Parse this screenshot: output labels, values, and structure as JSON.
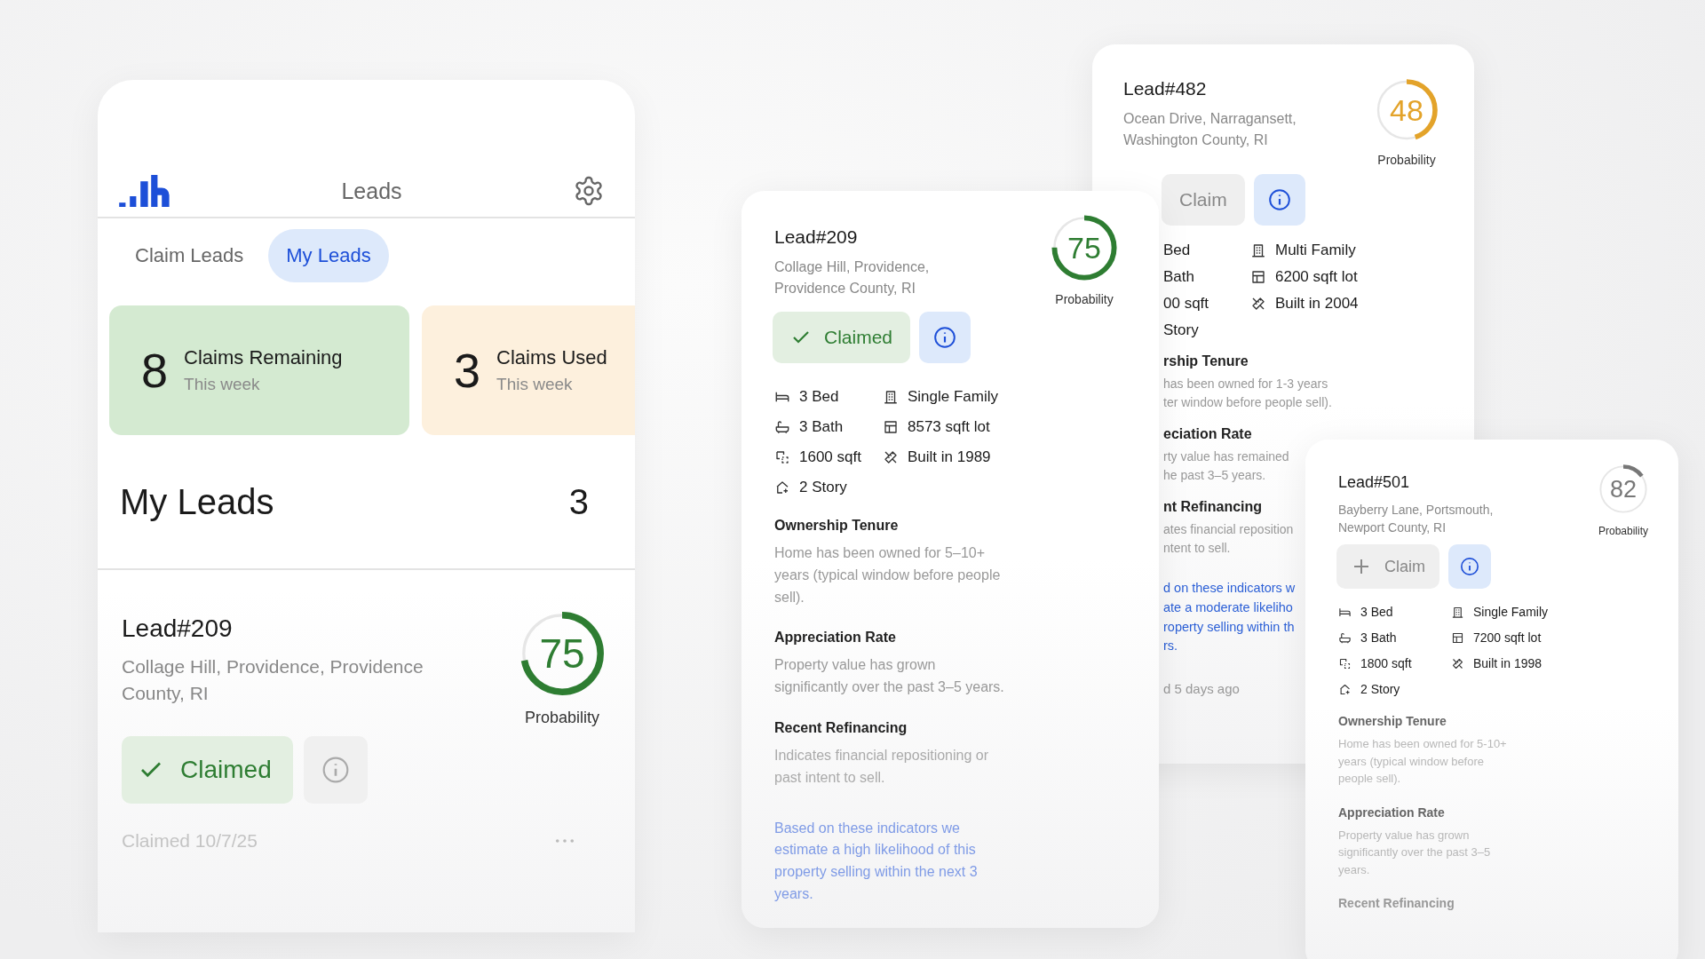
{
  "app": {
    "title": "Leads",
    "tabs": [
      {
        "label": "Claim Leads",
        "selected": false
      },
      {
        "label": "My Leads",
        "selected": true
      }
    ],
    "stats": [
      {
        "kind": "remaining",
        "value": "8",
        "label": "Claims Remaining",
        "sub": "This week"
      },
      {
        "kind": "used",
        "value": "3",
        "label": "Claims Used",
        "sub": "This week"
      }
    ],
    "section": {
      "title": "My Leads",
      "count": "3"
    },
    "lead": {
      "title": "Lead#209",
      "address": "Collage Hill, Providence, Providence County, RI",
      "probability": "75",
      "level": 0.72,
      "color": "#2e7d32",
      "probability_label": "Probability",
      "button": {
        "kind": "claimed",
        "label": "Claimed"
      },
      "claimed_date": "Claimed 10/7/25"
    }
  },
  "detail_cards": [
    {
      "kind": "full",
      "title": "Lead#209",
      "address": [
        "Collage Hill, Providence,",
        "Providence County, RI"
      ],
      "probability": "75",
      "level": 0.75,
      "color": "#2e7d32",
      "probability_label": "Probability",
      "button": {
        "kind": "claimed",
        "label": "Claimed"
      },
      "facts": [
        {
          "kind": "bed",
          "text": "3 Bed"
        },
        {
          "kind": "building",
          "text": "Single Family"
        },
        {
          "kind": "bath",
          "text": "3 Bath"
        },
        {
          "kind": "lot",
          "text": "8573 sqft lot"
        },
        {
          "kind": "area",
          "text": "1600 sqft"
        },
        {
          "kind": "ruler",
          "text": "Built in 1989"
        },
        {
          "kind": "story",
          "text": "2 Story"
        }
      ],
      "sections": [
        {
          "heading": "Ownership Tenure",
          "lines": [
            "Home has been owned for 5–10+",
            "years (typical window before people",
            "sell)."
          ]
        },
        {
          "heading": "Appreciation Rate",
          "lines": [
            "Property value has grown",
            "significantly over the past 3–5 years."
          ]
        },
        {
          "heading": "Recent Refinancing",
          "lines": [
            "Indicates financial repositioning or",
            "past intent to sell."
          ]
        }
      ],
      "summary": [
        "Based on these indicators we",
        "estimate a high likelihood of this",
        "property selling within the next 3",
        "years."
      ]
    },
    {
      "kind": "covered",
      "title": "Lead#482",
      "address": [
        "Ocean Drive, Narragansett,",
        "Washington County, RI"
      ],
      "probability": "48",
      "level": 0.45,
      "color": "#e3a32a",
      "probability_label": "Probability",
      "button": {
        "kind": "claim",
        "label": "Claim"
      },
      "facts": [
        {
          "kind": "text",
          "text": "Bed"
        },
        {
          "kind": "building",
          "text": "Multi Family"
        },
        {
          "kind": "text",
          "text": "Bath"
        },
        {
          "kind": "lot",
          "text": "6200 sqft lot"
        },
        {
          "kind": "text",
          "text": "00 sqft"
        },
        {
          "kind": "ruler",
          "text": "Built in 2004"
        },
        {
          "kind": "text",
          "text": "Story"
        }
      ],
      "sections": [
        {
          "heading": "rship Tenure",
          "lines": [
            "has been owned for 1-3 years",
            "ter window before people sell)."
          ]
        },
        {
          "heading": "eciation Rate",
          "lines": [
            "rty value has remained",
            "he past 3–5 years."
          ]
        },
        {
          "heading": "nt Refinancing",
          "lines": [
            "ates financial reposition",
            "ntent to sell."
          ]
        }
      ],
      "summary": [
        "d on these indicators w",
        "ate a moderate likeliho",
        "roperty selling within th",
        "rs."
      ],
      "footer": "d 5 days ago"
    },
    {
      "kind": "full",
      "title": "Lead#501",
      "address": [
        "Bayberry Lane, Portsmouth,",
        "Newport County, RI"
      ],
      "probability": "82",
      "level": 0.15,
      "color": "#777777",
      "probability_label": "Probability",
      "button": {
        "kind": "claim",
        "label": "Claim"
      },
      "facts": [
        {
          "kind": "bed",
          "text": "3 Bed"
        },
        {
          "kind": "building",
          "text": "Single Family"
        },
        {
          "kind": "bath",
          "text": "3 Bath"
        },
        {
          "kind": "lot",
          "text": "7200 sqft lot"
        },
        {
          "kind": "area",
          "text": "1800 sqft"
        },
        {
          "kind": "ruler",
          "text": "Built in 1998"
        },
        {
          "kind": "story",
          "text": "2 Story"
        }
      ],
      "sections": [
        {
          "heading": "Ownership Tenure",
          "lines": [
            "Home has been owned for 5-10+",
            "years (typical window before",
            "people sell)."
          ]
        },
        {
          "heading": "Appreciation Rate",
          "lines": [
            "Property value has grown",
            "significantly over the past 3–5",
            "years."
          ]
        },
        {
          "heading": "Recent Refinancing"
        }
      ]
    }
  ]
}
